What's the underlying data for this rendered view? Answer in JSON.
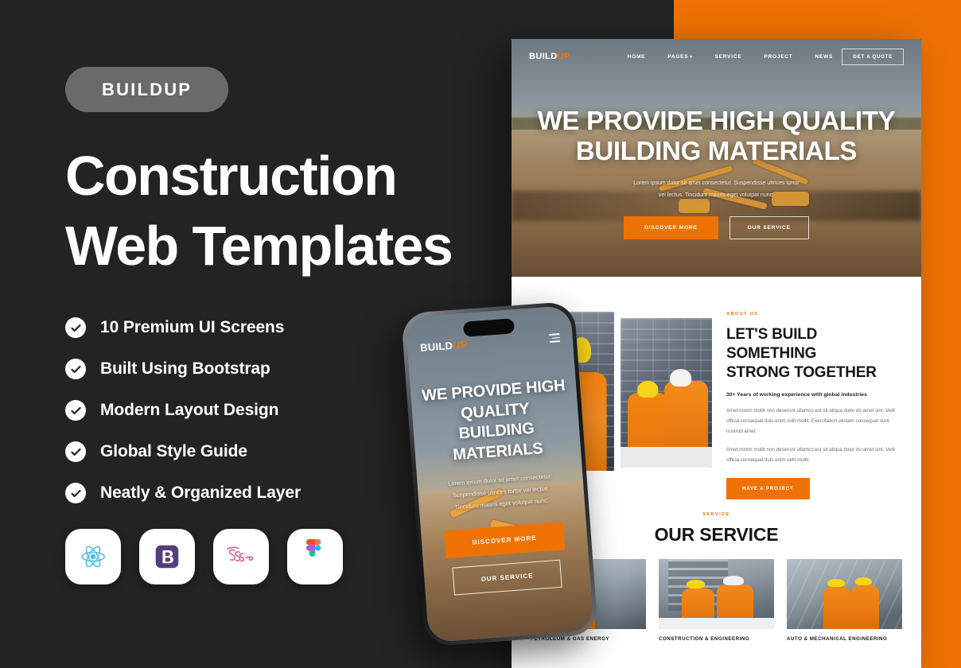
{
  "promo": {
    "badge": "BUILDUP",
    "headline_line1": "Construction",
    "headline_line2": "Web Templates",
    "features": [
      {
        "label": "10 Premium UI Screens",
        "icon": "check-circle-icon"
      },
      {
        "label": "Built Using Bootstrap",
        "icon": "check-circle-icon"
      },
      {
        "label": "Modern Layout Design",
        "icon": "check-circle-icon"
      },
      {
        "label": "Global Style Guide",
        "icon": "check-circle-icon"
      },
      {
        "label": "Neatly & Organized Layer",
        "icon": "check-circle-icon"
      }
    ],
    "tech_icons": [
      {
        "name": "react-icon",
        "label": "React"
      },
      {
        "name": "bootstrap-icon",
        "label": "Bootstrap"
      },
      {
        "name": "sass-icon",
        "label": "Sass"
      },
      {
        "name": "figma-icon",
        "label": "Figma"
      }
    ]
  },
  "colors": {
    "background_dark": "#232323",
    "accent_orange": "#EE7203",
    "badge_gray": "#6A6A6A",
    "text_white": "#FFFFFF"
  },
  "desktop_mockup": {
    "nav": {
      "logo_first": "BUILD",
      "logo_second": "UP",
      "links": [
        {
          "label": "HOME",
          "has_caret": false
        },
        {
          "label": "PAGES",
          "has_caret": true
        },
        {
          "label": "SERVICE",
          "has_caret": false
        },
        {
          "label": "PROJECT",
          "has_caret": false
        },
        {
          "label": "NEWS",
          "has_caret": false
        }
      ],
      "cta": "GET A QUOTE"
    },
    "hero": {
      "title_line1": "WE PROVIDE HIGH QUALITY",
      "title_line2": "BUILDING MATERIALS",
      "subtitle_line1": "Lorem ipsum dolor sit amet consectetur. Suspendisse ultrices tortor",
      "subtitle_line2": "vel lectus. Tincidunt mauris eget volutpat nunc.",
      "btn_primary": "DISCOVER MORE",
      "btn_secondary": "OUR SERVICE"
    },
    "about": {
      "eyebrow": "ABOUT US",
      "heading_line1": "LET'S BUILD SOMETHING",
      "heading_line2": "STRONG TOGETHER",
      "lead": "30+ Years of working experience with global industries",
      "paragraph1": "Amet minim mollit non deserunt ullamco est sit aliqua dolor do amet sint. Velit officia consequat duis enim velit mollit. Exercitation veniam consequat sunt nostrud amet.",
      "paragraph2": "Amet minim mollit non deserunt ullamco est sit aliqua dolor do amet sint. Velit officia consequat duis enim velit mollit.",
      "button": "HAVE A PROJECT"
    },
    "service": {
      "eyebrow": "SERVICE",
      "heading": "OUR SERVICE",
      "cards": [
        {
          "title": "PETROLEUM & GAS ENERGY"
        },
        {
          "title": "CONSTRUCTION & ENGINEERING"
        },
        {
          "title": "AUTO & MECHANICAL ENGINEERING"
        }
      ]
    }
  },
  "phone_mockup": {
    "logo_first": "BUILD",
    "logo_second": "UP",
    "menu_icon": "hamburger-menu-icon",
    "title_line1": "WE PROVIDE HIGH",
    "title_line2": "QUALITY BUILDING",
    "title_line3": "MATERIALS",
    "subtitle_line1": "Lorem ipsum dolor sit amet consectetur.",
    "subtitle_line2": "Suspendisse ultrices tortor vel lectus.",
    "subtitle_line3": "Tincidunt mauris eget volutpat nunc.",
    "btn_primary": "DISCOVER MORE",
    "btn_secondary": "OUR SERVICE"
  }
}
